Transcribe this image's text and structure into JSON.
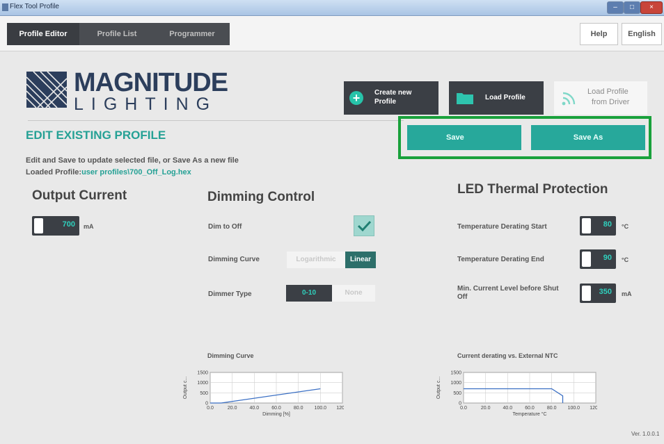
{
  "window": {
    "title": "Flex Tool Profile",
    "controls": [
      "–",
      "□",
      "×"
    ]
  },
  "nav": {
    "tabs": [
      {
        "label": "Profile Editor",
        "active": true
      },
      {
        "label": "Profile List",
        "active": false
      },
      {
        "label": "Programmer",
        "active": false
      }
    ],
    "help_label": "Help",
    "language_label": "English"
  },
  "logo": {
    "top": "MAGNITUDE",
    "bottom": "LIGHTING"
  },
  "actions": {
    "create_label_1": "Create new",
    "create_label_2": "Profile",
    "load_label": "Load Profile",
    "load_driver_label_1": "Load Profile",
    "load_driver_label_2": "from Driver",
    "save_label": "Save",
    "save_as_label": "Save As"
  },
  "heading": {
    "title": "EDIT EXISTING PROFILE",
    "subtitle": "Edit and Save to update selected file, or Save As a new file",
    "loaded_label": "Loaded Profile:",
    "loaded_value": "user profiles\\700_Off_Log.hex"
  },
  "output_current": {
    "title": "Output Current",
    "value": "700",
    "unit": "mA"
  },
  "dimming": {
    "title": "Dimming Control",
    "dim_to_off_label": "Dim to Off",
    "dim_to_off_checked": true,
    "curve_label": "Dimming Curve",
    "curve_options": [
      "Logarithmic",
      "Linear"
    ],
    "curve_selected": "Linear",
    "type_label": "Dimmer Type",
    "type_options": [
      "0-10",
      "None"
    ],
    "type_selected": "0-10"
  },
  "thermal": {
    "title": "LED Thermal Protection",
    "start_label": "Temperature Derating Start",
    "start_value": "80",
    "start_unit": "°C",
    "end_label": "Temperature Derating End",
    "end_value": "90",
    "end_unit": "°C",
    "min_label_1": "Min. Current Level before Shut",
    "min_label_2": "Off",
    "min_value": "350",
    "min_unit": "mA"
  },
  "chart_data": [
    {
      "type": "line",
      "title": "Dimming Curve",
      "xlabel": "Dimming [%]",
      "ylabel": "Output c...",
      "xlim": [
        0,
        120
      ],
      "ylim": [
        0,
        1500
      ],
      "x_ticks": [
        "0.0",
        "20.0",
        "40.0",
        "60.0",
        "80.0",
        "100.0",
        "120.0"
      ],
      "y_ticks": [
        "0",
        "500",
        "1000",
        "1500"
      ],
      "series": [
        {
          "x": [
            0,
            10,
            100
          ],
          "y": [
            0,
            0,
            700
          ]
        }
      ],
      "grid": true
    },
    {
      "type": "line",
      "title": "Current derating vs. External NTC",
      "xlabel": "Temperature °C",
      "ylabel": "Output c...",
      "xlim": [
        0,
        120
      ],
      "ylim": [
        0,
        1500
      ],
      "x_ticks": [
        "0.0",
        "20.0",
        "40.0",
        "60.0",
        "80.0",
        "100.0",
        "120.0"
      ],
      "y_ticks": [
        "0",
        "500",
        "1000",
        "1500"
      ],
      "series": [
        {
          "x": [
            0,
            80,
            90,
            90
          ],
          "y": [
            700,
            700,
            350,
            0
          ]
        }
      ],
      "grid": true
    }
  ],
  "footer": {
    "version": "Ver. 1.0.0.1"
  },
  "colors": {
    "accent": "#27a89b",
    "dark": "#3b3f45",
    "highlight_box": "#19a13b",
    "value_text": "#2fd0bd"
  }
}
